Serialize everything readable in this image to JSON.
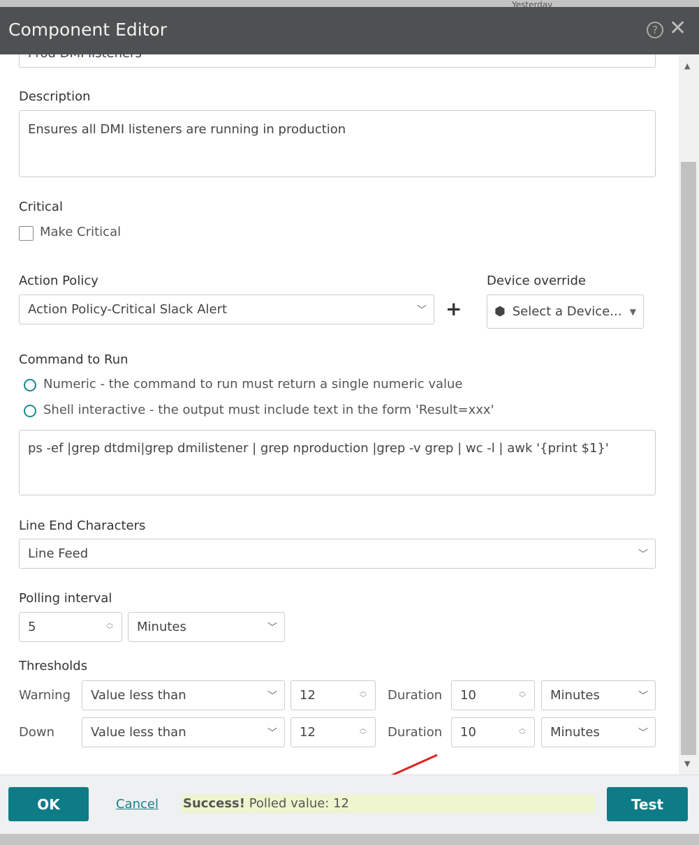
{
  "background": {
    "partial_text": "Yesterday"
  },
  "dialog": {
    "title": "Component Editor",
    "help_icon": "question-circle-icon",
    "close_icon": "close-x-icon"
  },
  "form": {
    "name_value": "Prod DMI listeners",
    "description": {
      "label": "Description",
      "value": "Ensures all DMI listeners are running in production"
    },
    "critical": {
      "label": "Critical",
      "checkbox_label": "Make Critical",
      "checked": false
    },
    "action_policy": {
      "label": "Action Policy",
      "value": "Action Policy-Critical Slack Alert",
      "add_label": "+"
    },
    "device_override": {
      "label": "Device override",
      "value": "Select a Device..."
    },
    "command": {
      "label": "Command to Run",
      "options": [
        {
          "label": "Numeric - the command to run must return a single numeric value",
          "selected": true
        },
        {
          "label": "Shell interactive - the output must include text in the form 'Result=xxx'",
          "selected": false
        }
      ],
      "value": "ps -ef |grep dtdmi|grep dmilistener | grep nproduction |grep -v grep | wc -l | awk '{print $1}'"
    },
    "line_end": {
      "label": "Line End Characters",
      "value": "Line Feed"
    },
    "polling": {
      "label": "Polling interval",
      "value": "5",
      "unit": "Minutes"
    },
    "thresholds": {
      "label": "Thresholds",
      "rows": [
        {
          "name": "Warning",
          "condition": "Value less than",
          "value": "12",
          "duration_label": "Duration",
          "duration": "10",
          "unit": "Minutes"
        },
        {
          "name": "Down",
          "condition": "Value less than",
          "value": "12",
          "duration_label": "Duration",
          "duration": "10",
          "unit": "Minutes"
        }
      ]
    }
  },
  "footer": {
    "ok": "OK",
    "cancel": "Cancel",
    "status_bold": "Success!",
    "status_text": " Polled value: 12",
    "test": "Test",
    "status_bg": "#eef5cf",
    "accent": "#0e7c86"
  }
}
